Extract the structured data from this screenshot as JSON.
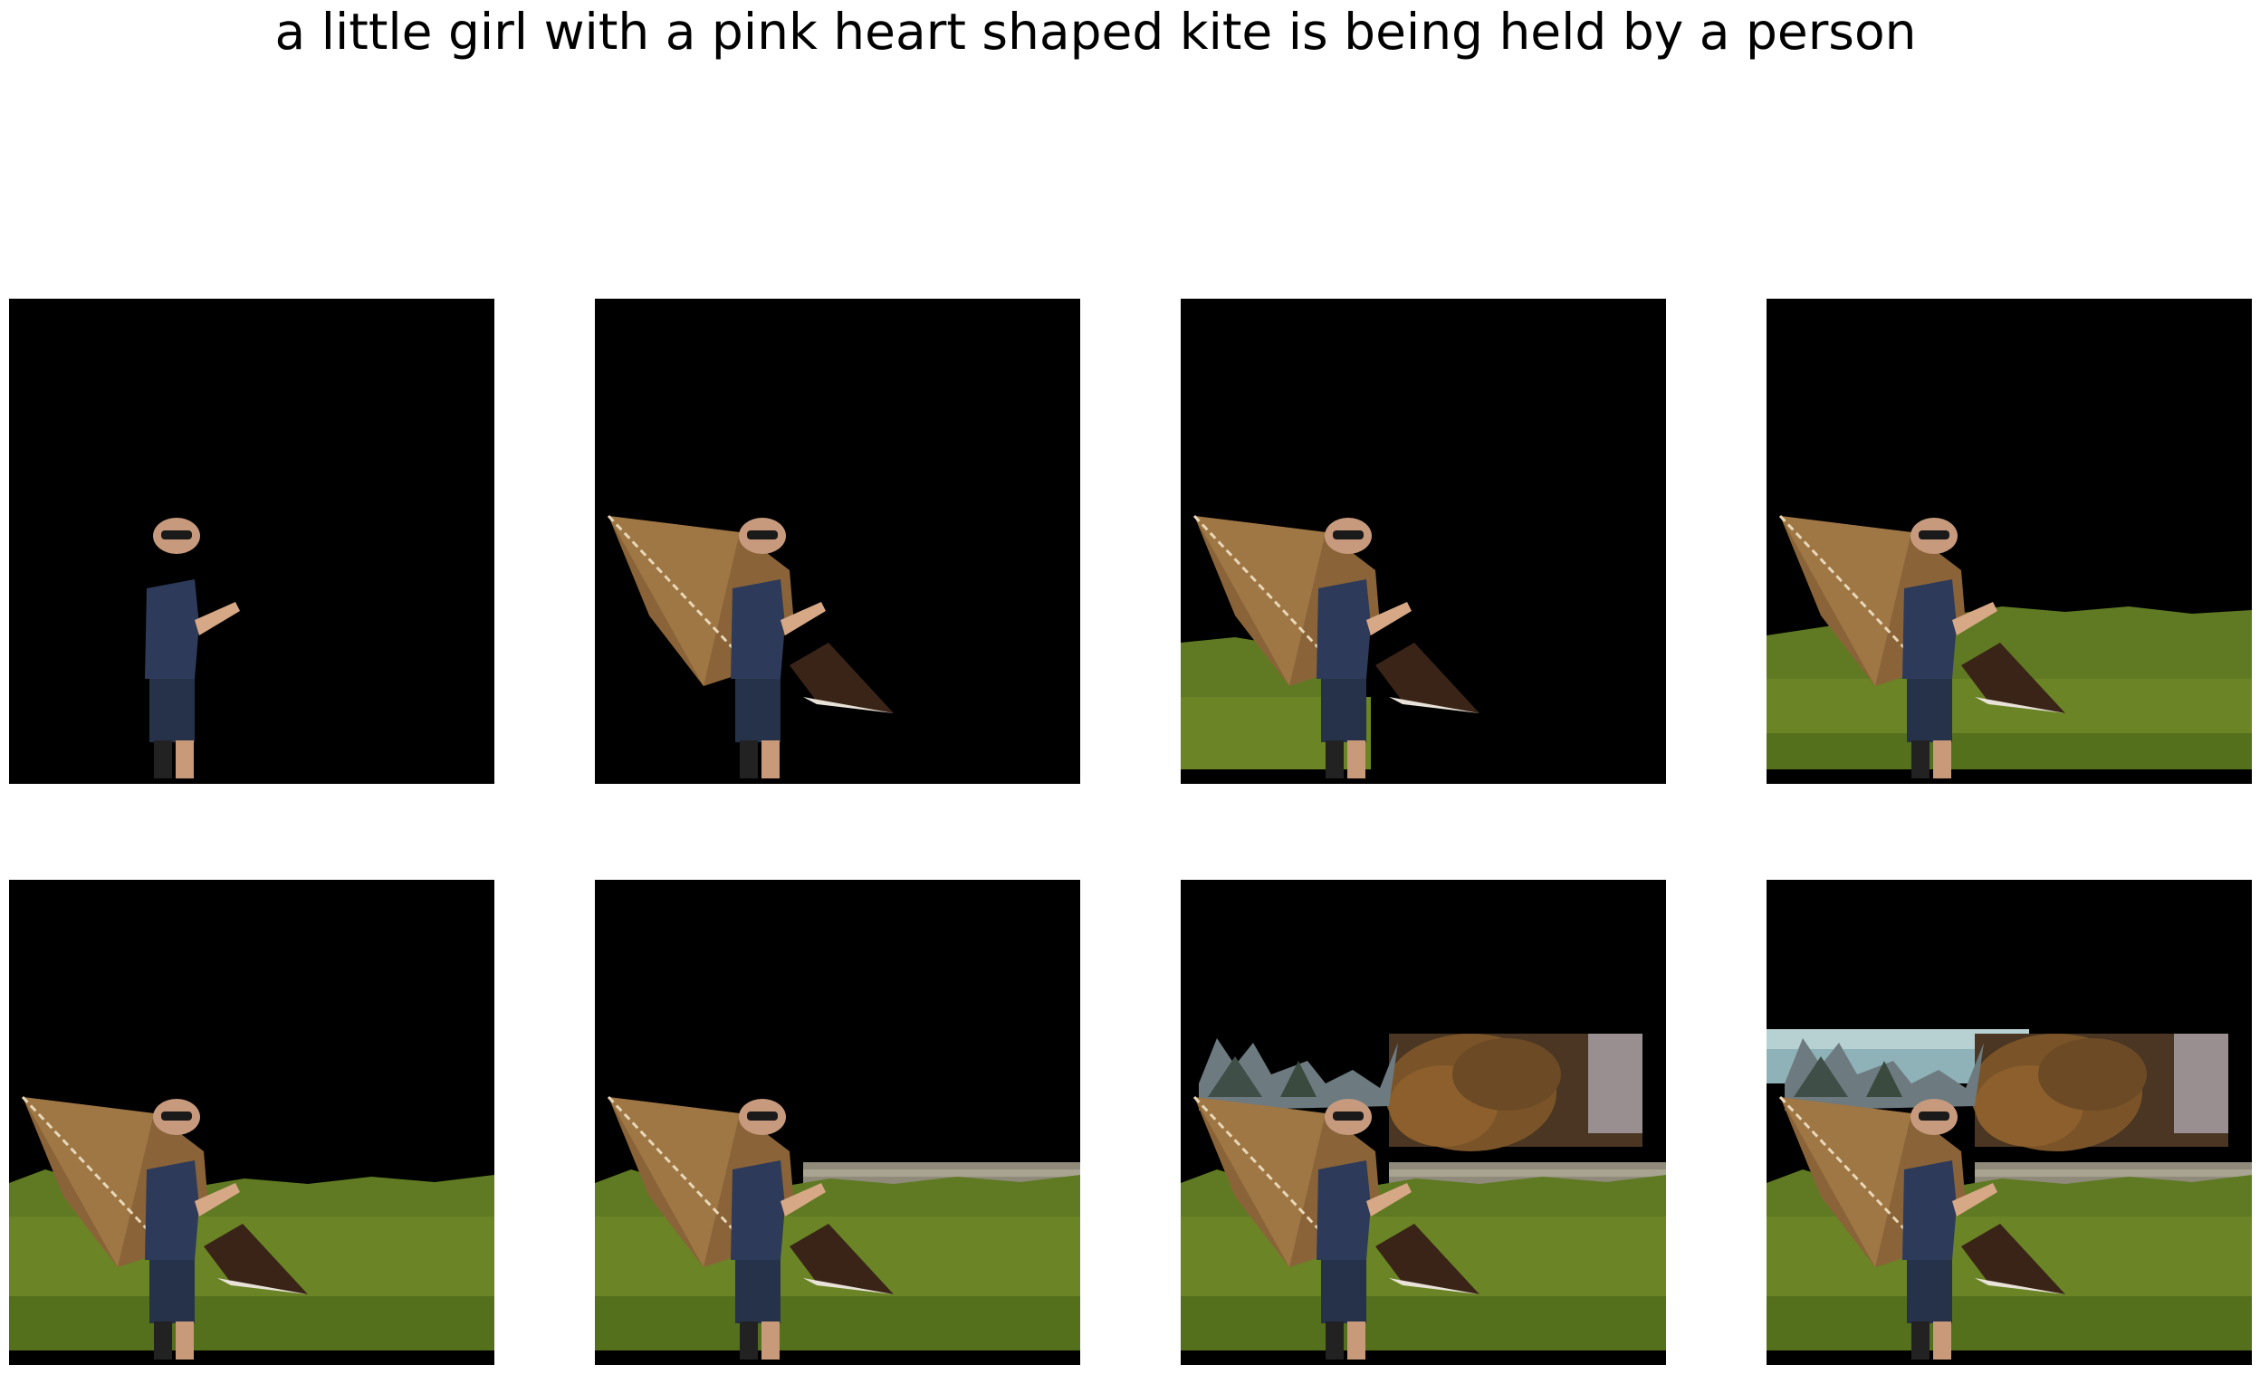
{
  "figure": {
    "title": "a little girl with a pink heart shaped kite is being held by a person"
  },
  "panels": [
    {
      "index": 1,
      "layers": [
        "person"
      ],
      "colors": {
        "background": "#000000"
      }
    },
    {
      "index": 2,
      "layers": [
        "person",
        "kite"
      ],
      "colors": {
        "background": "#000000",
        "kite": "#8a6438"
      }
    },
    {
      "index": 3,
      "layers": [
        "person",
        "kite",
        "grass-left"
      ],
      "colors": {
        "background": "#000000",
        "grass": "#5f7a22"
      }
    },
    {
      "index": 4,
      "layers": [
        "person",
        "kite",
        "grass"
      ],
      "colors": {
        "background": "#000000",
        "grass": "#5f7a22"
      }
    },
    {
      "index": 5,
      "layers": [
        "person",
        "kite",
        "grass-full"
      ],
      "colors": {
        "background": "#000000",
        "grass": "#5f7a22"
      }
    },
    {
      "index": 6,
      "layers": [
        "person",
        "kite",
        "grass-full",
        "path"
      ],
      "colors": {
        "background": "#000000",
        "path": "#8f8a7a"
      }
    },
    {
      "index": 7,
      "layers": [
        "person",
        "kite",
        "grass-full",
        "path",
        "trees"
      ],
      "colors": {
        "background": "#000000",
        "trees": "#6b4a25"
      }
    },
    {
      "index": 8,
      "layers": [
        "person",
        "kite",
        "grass-full",
        "path",
        "trees",
        "sky"
      ],
      "colors": {
        "background": "#000000",
        "sky": "#8fb2b8"
      }
    }
  ]
}
